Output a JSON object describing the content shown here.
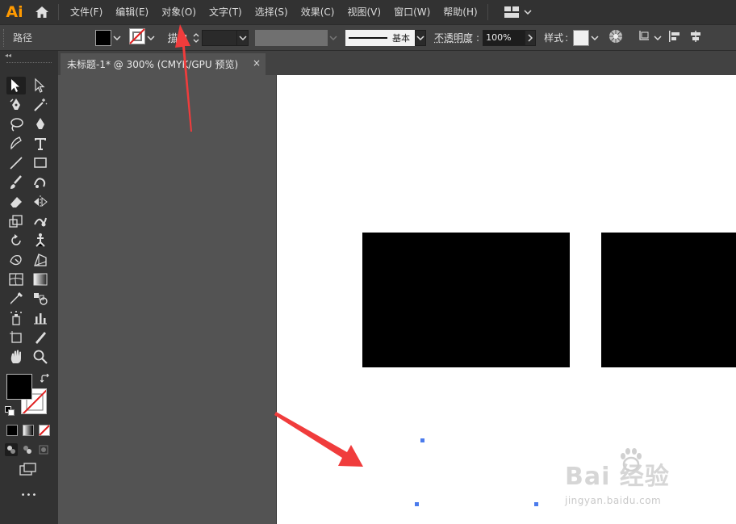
{
  "app": {
    "logo": "Ai"
  },
  "menu": [
    "文件(F)",
    "编辑(E)",
    "对象(O)",
    "文字(T)",
    "选择(S)",
    "效果(C)",
    "视图(V)",
    "窗口(W)",
    "帮助(H)"
  ],
  "control_bar": {
    "selection_type": "路径",
    "stroke_label": "描边",
    "brush_style": "基本",
    "opacity_label": "不透明度",
    "opacity_value": "100%",
    "style_label": "样式"
  },
  "document_tab": {
    "title": "未标题-1* @ 300% (CMYK/GPU 预览)",
    "close": "×"
  },
  "tools": [
    "selection-tool",
    "direct-selection-tool",
    "pen-tool",
    "magic-wand-tool",
    "lasso-tool",
    "curvature-tool",
    "brush-tool",
    "type-tool",
    "line-tool",
    "rectangle-tool",
    "paintbrush-tool",
    "shaper-tool",
    "eraser-tool",
    "reflect-tool",
    "scale-tool",
    "warp-tool",
    "rotate-tool",
    "puppet-warp-tool",
    "free-transform-tool",
    "perspective-tool",
    "mesh-tool",
    "gradient-tool",
    "eyedropper-tool",
    "blend-tool",
    "symbol-sprayer-tool",
    "graph-tool",
    "artboard-tool",
    "slice-tool",
    "hand-tool",
    "zoom-tool"
  ],
  "colors": {
    "fill": "#000000",
    "stroke": "none",
    "annotation_arrow": "#f03c3c",
    "anchor_point": "#4b7bec"
  },
  "watermark": {
    "brand": "Bai 经验",
    "url": "jingyan.baidu.com"
  },
  "more_tools": "•••"
}
